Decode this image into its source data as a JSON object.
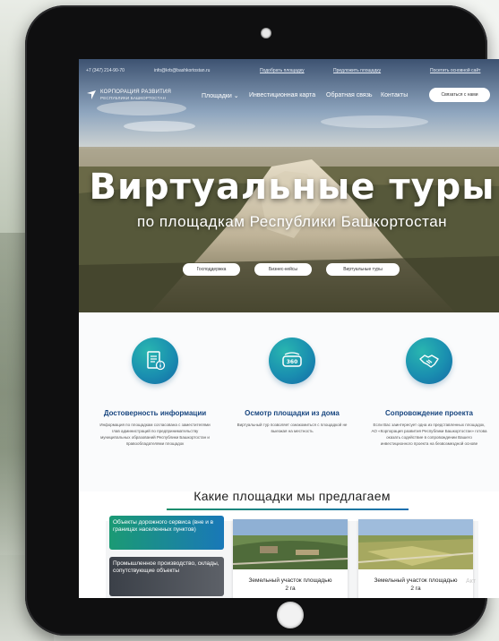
{
  "topbar": {
    "phone": "+7 (347) 214-90-70",
    "email": "info@krb@bashkortostan.ru",
    "suggest": "Подобрать площадку",
    "offer": "Предложить площадку",
    "old_site": "Посетить основной сайт"
  },
  "logo": {
    "line1": "КОРПОРАЦИЯ РАЗВИТИЯ",
    "line2": "РЕСПУБЛИКИ БАШКОРТОСТАН"
  },
  "nav": {
    "items": [
      "Площадки ⌄",
      "Инвестиционная карта",
      "Обратная связь",
      "Контакты"
    ],
    "contact_button": "Связаться с нами"
  },
  "hero": {
    "title": "Виртуальные туры",
    "subtitle": "по площадкам Республики Башкортостан",
    "pills": [
      "Господдержка",
      "Бизнес-кейсы",
      "Виртуальные туры"
    ]
  },
  "features": [
    {
      "title": "Достоверность информации",
      "text": "Информация по площадкам согласована с заместителями глав администраций по предпринимательству муниципальных образований Республики Башкортостан и правообладателями площадок"
    },
    {
      "title": "Осмотр площадки из дома",
      "text": "Виртуальный тур позволяет ознакомиться с площадкой не выезжая на местность"
    },
    {
      "title": "Сопровождение проекта",
      "text": "Если Вас заинтересует одна из представленных площадок, АО «Корпорация развития Республики Башкортостан» готова оказать содействие в сопровождении Вашего инвестиционного проекта на безвозмездной основе"
    }
  ],
  "section": {
    "title": "Какие площадки мы предлагаем"
  },
  "tiles": [
    "Объекты дорожного сервиса (вне и в границах населенных пунктов)",
    "Промышленное производство, склады, сопутствующие объекты"
  ],
  "cards": [
    {
      "caption_line1": "Земельный участок площадью",
      "caption_line2": "2 га"
    },
    {
      "caption_line1": "Земельный участок площадью",
      "caption_line2": "2 га"
    }
  ],
  "icons": [
    "document-info-icon",
    "vr-360-icon",
    "handshake-icon"
  ],
  "watermark": "Акт",
  "colors": {
    "brand_blue": "#17457f",
    "accent_teal": "#1a8fb0",
    "accent_green": "#1b9a74",
    "bezel": "#0f0f10"
  }
}
